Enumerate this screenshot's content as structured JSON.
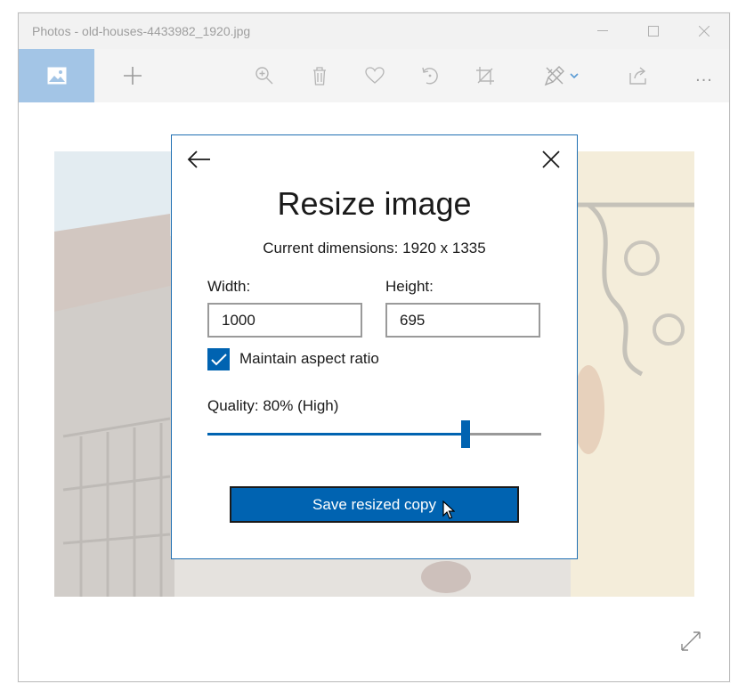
{
  "window": {
    "title": "Photos - old-houses-4433982_1920.jpg"
  },
  "toolbar": {
    "buttons": [
      {
        "icon": "image-icon"
      },
      {
        "icon": "plus-icon"
      },
      {
        "icon": "zoom-icon"
      },
      {
        "icon": "trash-icon"
      },
      {
        "icon": "heart-icon"
      },
      {
        "icon": "rotate-icon"
      },
      {
        "icon": "crop-icon"
      },
      {
        "icon": "edit-draw-icon"
      },
      {
        "icon": "share-icon"
      },
      {
        "icon": "more-icon"
      }
    ],
    "more_label": "..."
  },
  "dialog": {
    "title": "Resize image",
    "current_dimensions": "Current dimensions: 1920 x 1335",
    "width_label": "Width:",
    "width_value": "1000",
    "height_label": "Height:",
    "height_value": "695",
    "maintain_aspect_label": "Maintain aspect ratio",
    "maintain_aspect_checked": true,
    "quality_label": "Quality: 80% (High)",
    "quality_value": 0.8,
    "save_label": "Save resized copy"
  },
  "colors": {
    "accent": "#0063b1",
    "home_tile": "#a3c5e6",
    "toolbar_bg": "#f4f4f4",
    "titlebar_bg": "#f2f2f2"
  }
}
